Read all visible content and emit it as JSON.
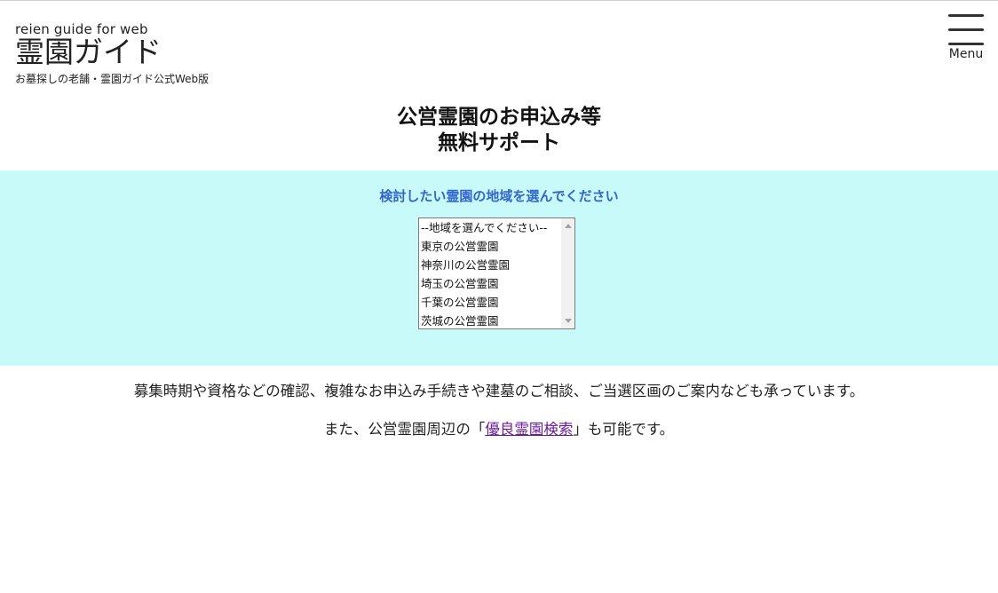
{
  "header": {
    "logo_en": "reien guide for web",
    "logo_ja": "霊園ガイド",
    "logo_sub": "お墓探しの老舗・霊園ガイド公式Web版",
    "menu_label": "Menu"
  },
  "headline": {
    "line1": "公営霊園のお申込み等",
    "line2": "無料サポート"
  },
  "region": {
    "title": "検討したい霊園の地域を選んでください",
    "options": [
      "--地域を選んでください--",
      "東京の公営霊園",
      "神奈川の公営霊園",
      "埼玉の公営霊園",
      "千葉の公営霊園",
      "茨城の公営霊園"
    ]
  },
  "info": {
    "line1": "募集時期や資格などの確認、複雑なお申込み手続きや建墓のご相談、ご当選区画のご案内なども承っています。",
    "line2_before": "また、公営霊園周辺の「",
    "line2_link": "優良霊園検索",
    "line2_after": "」も可能です。"
  },
  "colors": {
    "band_background": "#c8fafa",
    "band_title": "#3366cc",
    "link_visited": "#6a1b9a"
  },
  "icons": {
    "menu": "hamburger-menu-icon"
  }
}
